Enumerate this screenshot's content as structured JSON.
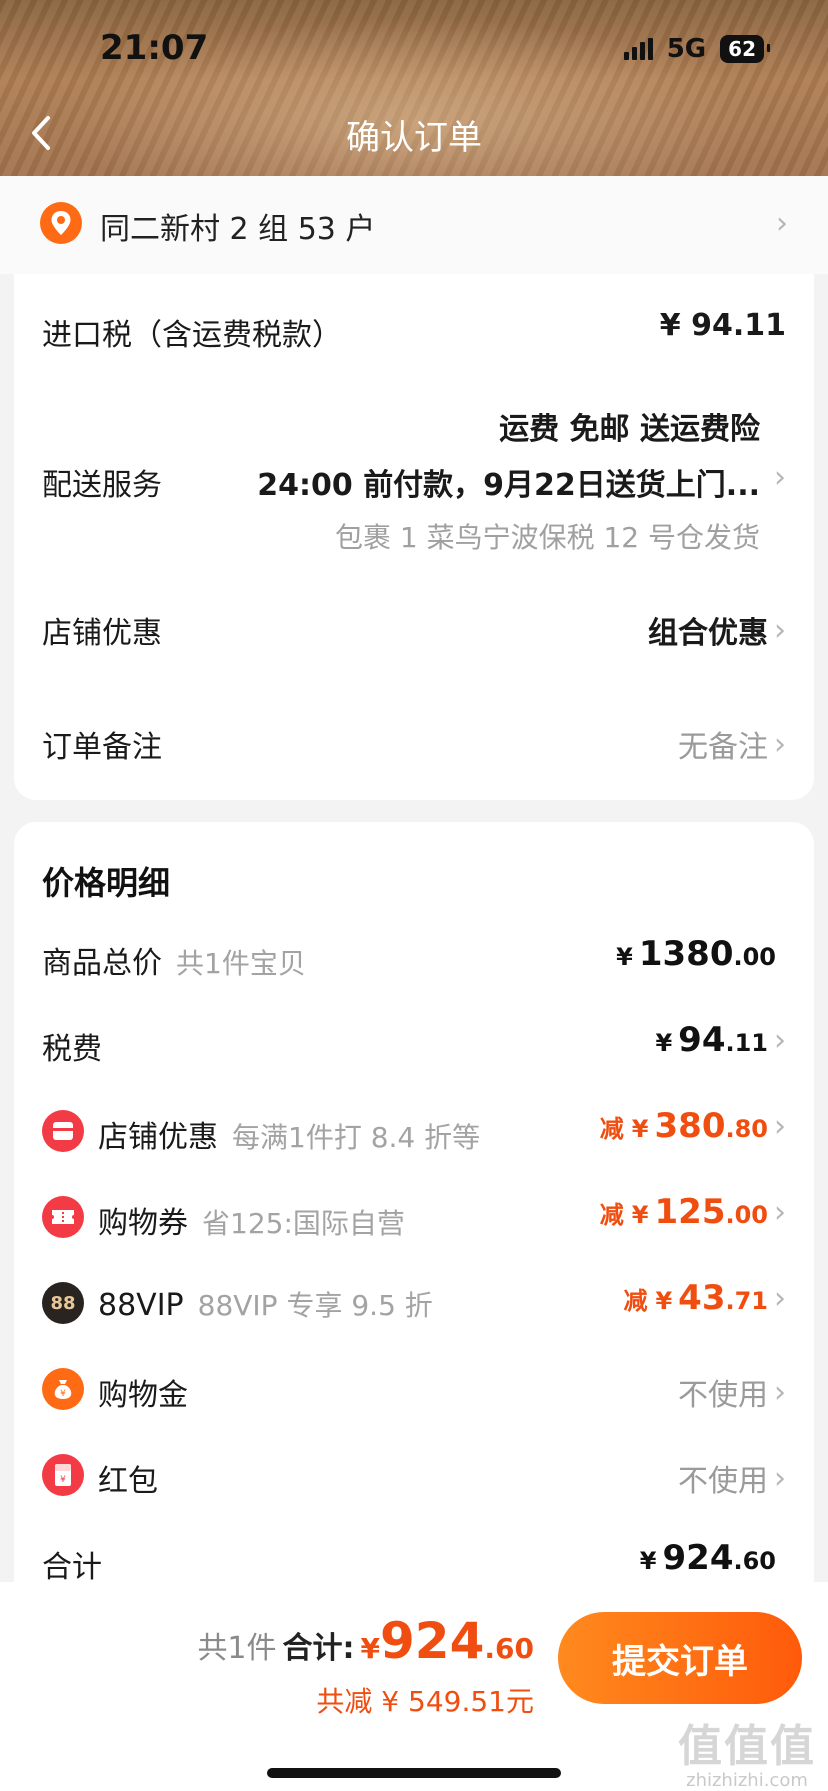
{
  "status_bar": {
    "time": "21:07",
    "network": "5G",
    "battery": "62"
  },
  "header": {
    "title": "确认订单"
  },
  "address": {
    "text": "同二新村 2 组 53 户"
  },
  "order_info": {
    "import_tax": {
      "label": "进口税（含运费税款）",
      "value": "¥ 94.11"
    },
    "delivery": {
      "label": "配送服务",
      "line1": "运费 免邮 送运费险",
      "line2": "24:00 前付款，9月22日送货上门...",
      "line3": "包裹 1 菜鸟宁波保税 12 号仓发货"
    },
    "shop_discount": {
      "label": "店铺优惠",
      "value": "组合优惠"
    },
    "note": {
      "label": "订单备注",
      "value": "无备注"
    }
  },
  "price_detail": {
    "title": "价格明细",
    "goods_total": {
      "label": "商品总价",
      "sub": "共1件宝贝",
      "currency": "¥",
      "int": "1380",
      "dec": ".00"
    },
    "tax": {
      "label": "税费",
      "currency": "¥",
      "int": "94",
      "dec": ".11"
    },
    "shop_discount": {
      "label": "店铺优惠",
      "sub": "每满1件打 8.4 折等",
      "minus": "减",
      "currency": "¥",
      "int": "380",
      "dec": ".80"
    },
    "coupon": {
      "label": "购物券",
      "sub": "省125:国际自营",
      "minus": "减",
      "currency": "¥",
      "int": "125",
      "dec": ".00"
    },
    "vip": {
      "label": "88VIP",
      "icon_text": "88",
      "sub": "88VIP 专享 9.5 折",
      "minus": "减",
      "currency": "¥",
      "int": "43",
      "dec": ".71"
    },
    "shopping_gold": {
      "label": "购物金",
      "value": "不使用"
    },
    "red_packet": {
      "label": "红包",
      "value": "不使用"
    },
    "total": {
      "label": "合计",
      "currency": "¥",
      "int": "924",
      "dec": ".60"
    }
  },
  "bottom_bar": {
    "count": "共1件",
    "sum_label": "合计:",
    "currency": "¥",
    "int": "924",
    "dec": ".60",
    "saved": "共减 ¥ 549.51元",
    "submit": "提交订单"
  },
  "watermark": {
    "big": "值值值",
    "small": "zhizhizhi.com"
  },
  "colors": {
    "accent": "#f04e10",
    "button": "#ff6a10",
    "header": "#a47550"
  }
}
